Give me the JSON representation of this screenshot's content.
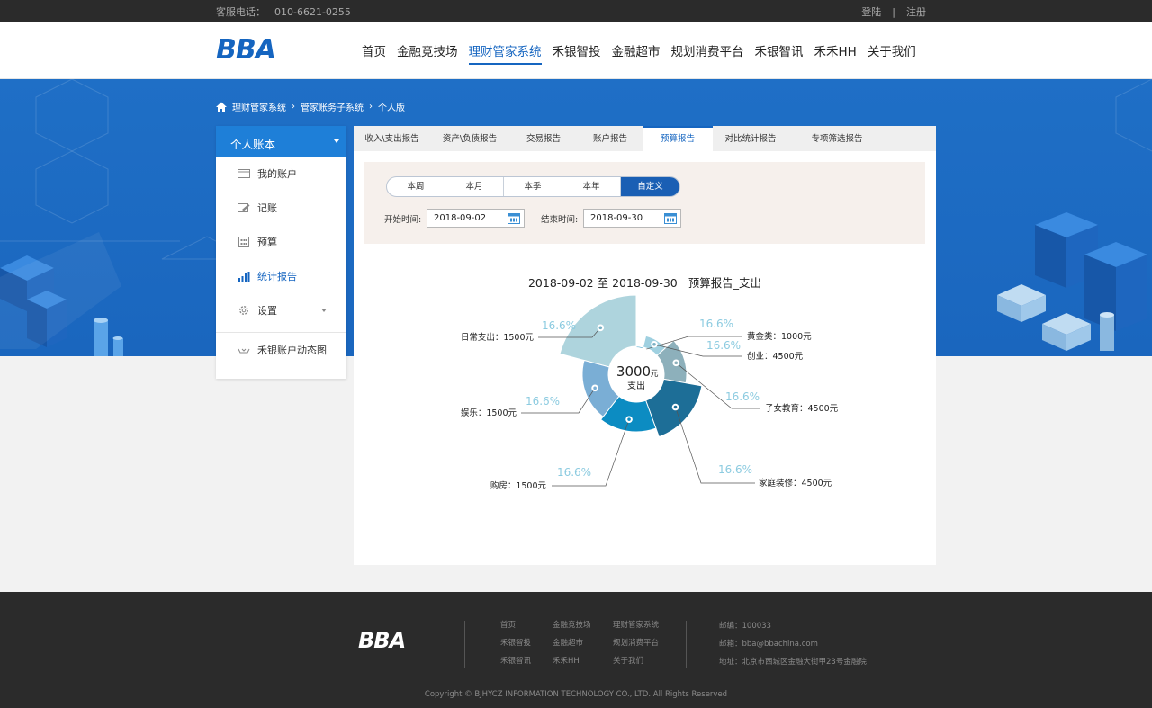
{
  "topbar": {
    "hotline_label": "客服电话：",
    "hotline_number": "010-6621-0255",
    "login": "登陆",
    "separator": "|",
    "register": "注册"
  },
  "header": {
    "logo": "BBA",
    "nav": [
      "首页",
      "金融竞技场",
      "理财管家系统",
      "禾银智投",
      "金融超市",
      "规划消费平台",
      "禾银智讯",
      "禾禾HH",
      "关于我们"
    ],
    "nav_active_index": 2
  },
  "breadcrumb": [
    "理财管家系统",
    "管家账务子系统",
    "个人版"
  ],
  "sidebar": {
    "title": "个人账本",
    "items": [
      {
        "label": "我的账户",
        "icon": "card-icon"
      },
      {
        "label": "记账",
        "icon": "edit-icon"
      },
      {
        "label": "预算",
        "icon": "calculator-icon"
      },
      {
        "label": "统计报告",
        "icon": "bar-chart-icon"
      },
      {
        "label": "设置",
        "icon": "gear-icon"
      }
    ],
    "active_index": 3,
    "bottom_item": "禾银账户动态图"
  },
  "tabs": [
    "收入\\支出报告",
    "资产\\负债报告",
    "交易报告",
    "账户报告",
    "预算报告",
    "对比统计报告",
    "专项筛选报告"
  ],
  "tabs_active_index": 4,
  "filter": {
    "periods": [
      "本周",
      "本月",
      "本季",
      "本年",
      "自定义"
    ],
    "period_active_index": 4,
    "start_label": "开始时间:",
    "start_value": "2018-09-02",
    "end_label": "结束时间:",
    "end_value": "2018-09-30"
  },
  "chart_title": {
    "start": "2018-09-02",
    "to": "至",
    "end": "2018-09-30",
    "name": "预算报告_支出"
  },
  "chart_data": {
    "type": "pie",
    "variant": "nightingale-rose",
    "center_value": "3000",
    "center_unit": "元",
    "center_label": "支出",
    "slices": [
      {
        "name": "日常支出",
        "value": 1500,
        "label": "日常支出：1500元",
        "pct": "16.6%",
        "color": "#aed4dd"
      },
      {
        "name": "黄金类",
        "value": 1000,
        "label": "黄金类：1000元",
        "pct": "16.6%",
        "color": "#1e90c0"
      },
      {
        "name": "创业",
        "value": 4500,
        "label": "创业：4500元",
        "pct": "16.6%",
        "color": "#9fd0e0"
      },
      {
        "name": "子女教育",
        "value": 4500,
        "label": "子女教育：4500元",
        "pct": "16.6%",
        "color": "#8db0bb"
      },
      {
        "name": "家庭装修",
        "value": 4500,
        "label": "家庭装修：4500元",
        "pct": "16.6%",
        "color": "#1d6e97"
      },
      {
        "name": "购房",
        "value": 1500,
        "label": "购房：1500元",
        "pct": "16.6%",
        "color": "#0c8cc2"
      },
      {
        "name": "娱乐",
        "value": 1500,
        "label": "娱乐：1500元",
        "pct": "16.6%",
        "color": "#7aaed5"
      }
    ]
  },
  "footer": {
    "logo": "BBA",
    "links": [
      [
        "首页",
        "金融竞技场",
        "理财管家系统"
      ],
      [
        "禾银智投",
        "金融超市",
        "规划消费平台"
      ],
      [
        "禾银智讯",
        "禾禾HH",
        "关于我们"
      ]
    ],
    "postcode": "邮编：100033",
    "email": "邮箱：bba@bbachina.com",
    "address": "地址：北京市西城区金融大街甲23号金融院",
    "copyright": "Copyright © BJHYCZ INFORMATION TECHNOLOGY CO., LTD. All Rights Reserved"
  },
  "colors": {
    "brand_blue": "#1565c0",
    "sidebar_head": "#1e7fd8",
    "hero_bg": "#1f6fc6",
    "footer_bg": "#2b2b2b"
  }
}
